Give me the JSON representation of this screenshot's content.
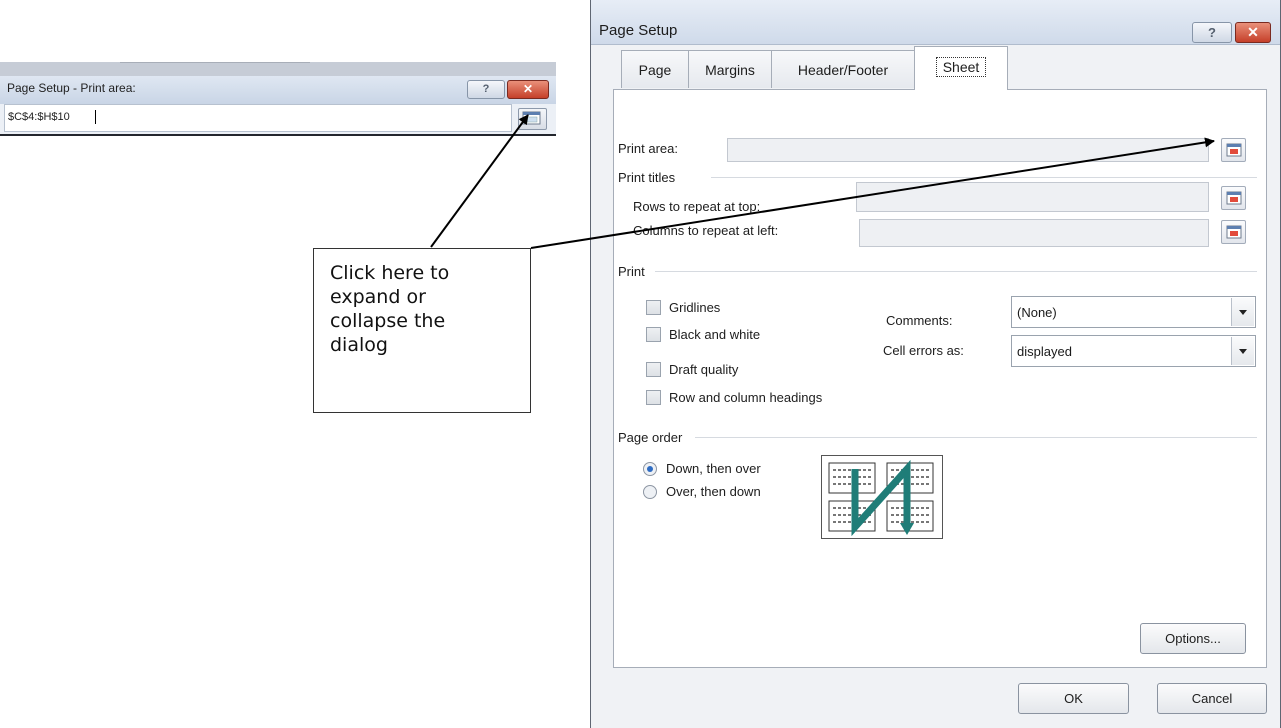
{
  "mini_dialog": {
    "title": "Page Setup - Print area:",
    "value": "$C$4:$H$10",
    "help_label": "?"
  },
  "dialog": {
    "title": "Page Setup",
    "help_label": "?",
    "close_label": "x",
    "tabs": [
      "Page",
      "Margins",
      "Header/Footer",
      "Sheet"
    ],
    "active_tab": "Sheet",
    "print_area_label": "Print area:",
    "print_titles_heading": "Print titles",
    "rows_repeat_label": "Rows to repeat at top:",
    "cols_repeat_label": "Columns to repeat at left:",
    "print_heading": "Print",
    "checkboxes": [
      "Gridlines",
      "Black and white",
      "Draft quality",
      "Row and column headings"
    ],
    "comments_label": "Comments:",
    "comments_value": "(None)",
    "cell_errors_label": "Cell errors as:",
    "cell_errors_value": "displayed",
    "page_order_heading": "Page order",
    "radio_down_over": "Down, then over",
    "radio_over_down": "Over, then down",
    "selected_order": "Down, then over",
    "options_button": "Options...",
    "ok_button": "OK",
    "cancel_button": "Cancel"
  },
  "callout": {
    "lines": [
      "Click here to",
      "expand or",
      "collapse the",
      "dialog"
    ]
  },
  "colors": {
    "accent": "#2f6cc3",
    "close_button": "#c5402a",
    "arrow_teal": "#2a8f8a"
  }
}
